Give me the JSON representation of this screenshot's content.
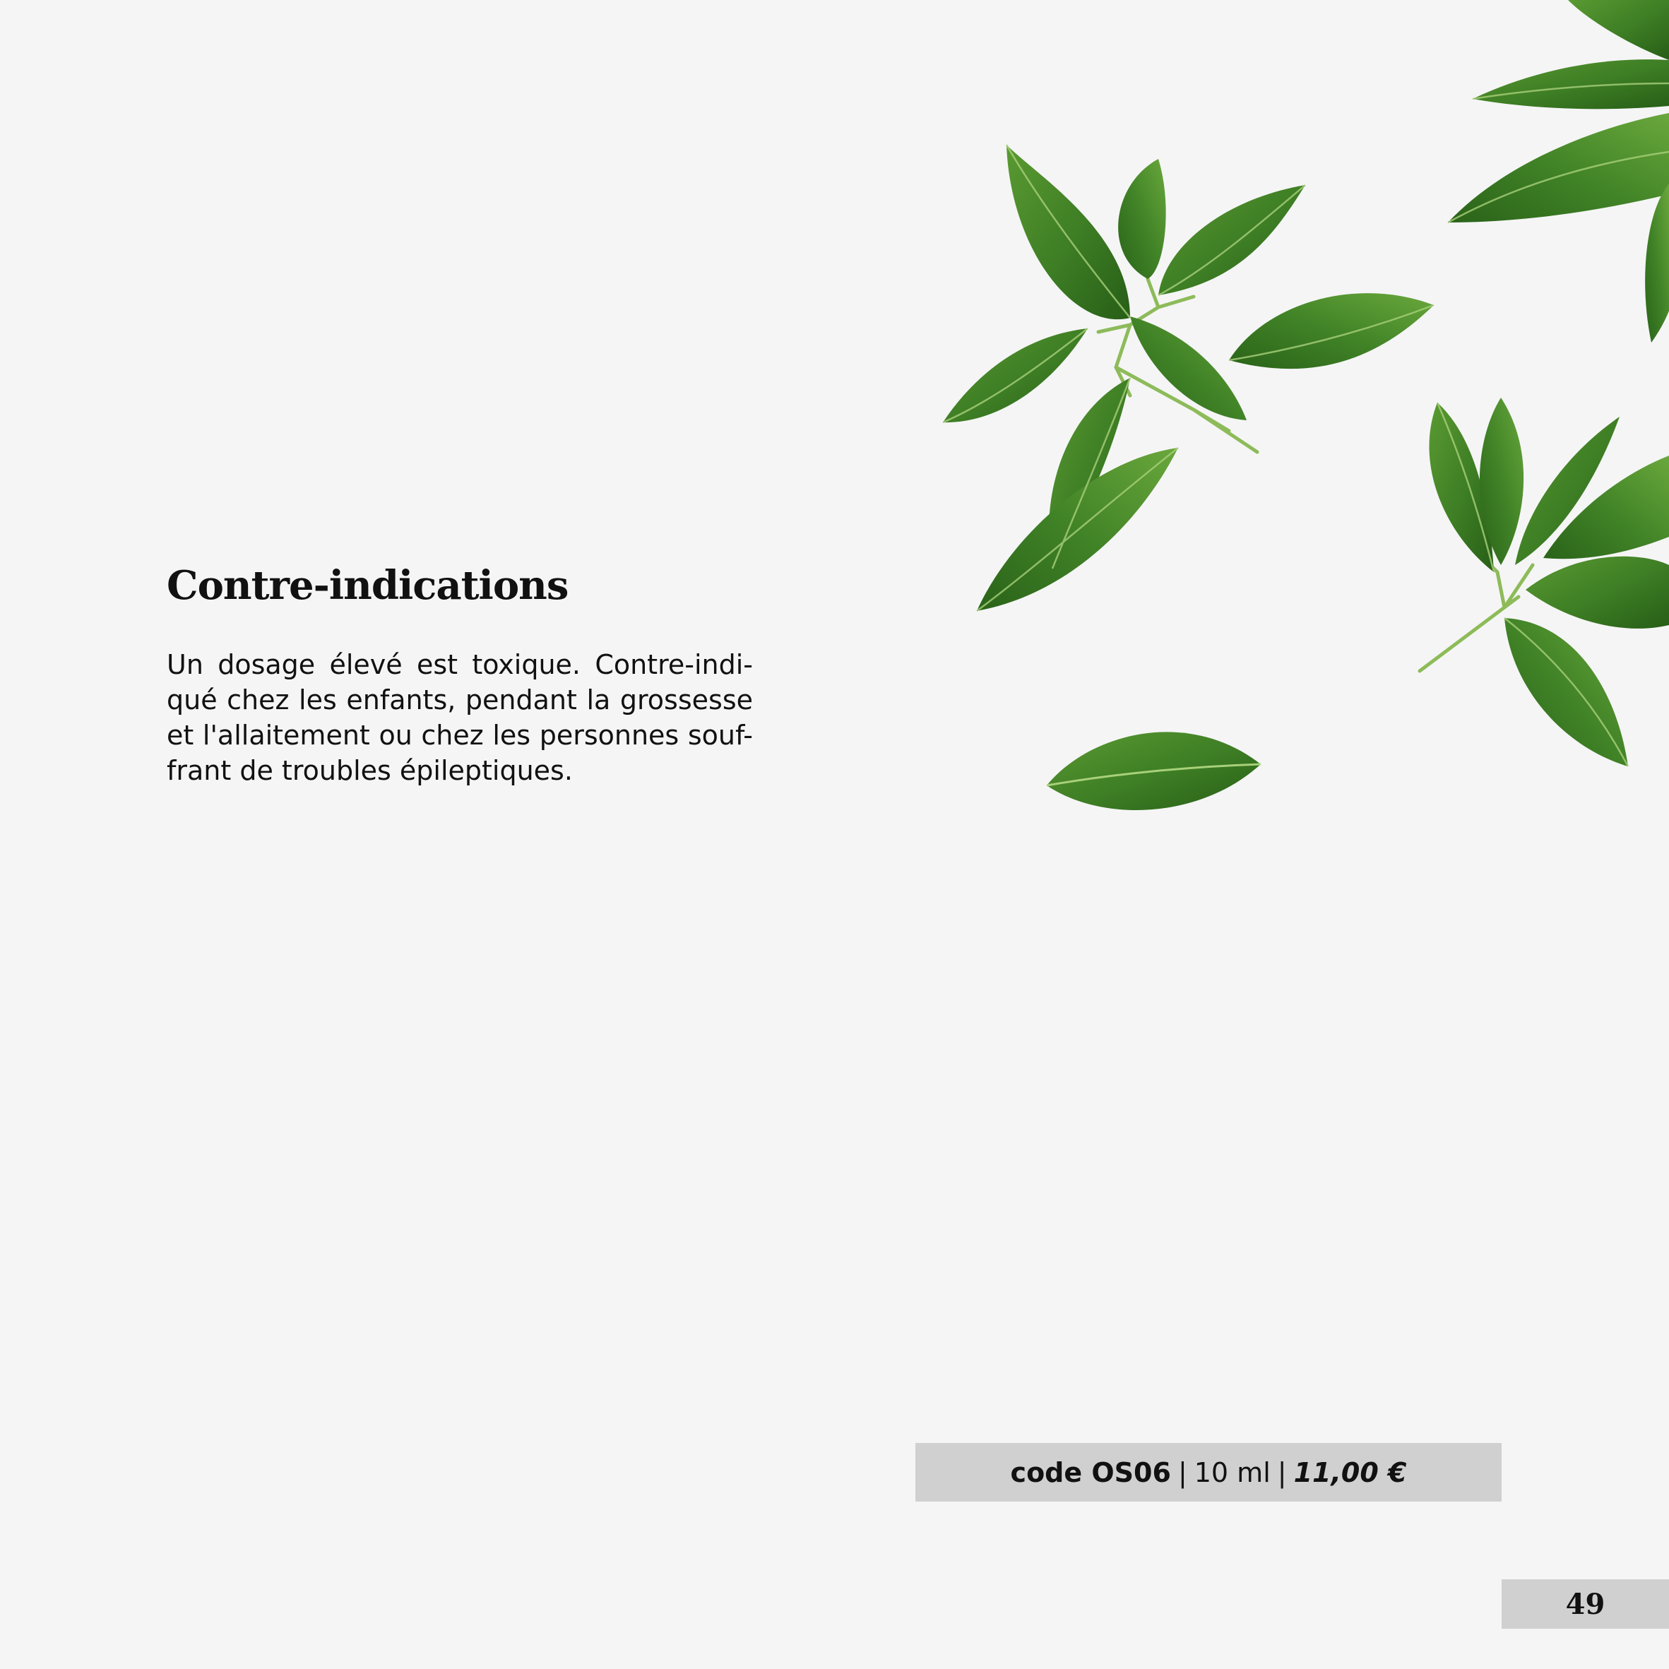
{
  "heading": "Contre-indications",
  "body_lines": [
    "Un dosage élevé est toxique. Contre-indi-",
    "qué chez les enfants, pendant la grossesse",
    "et l'allaitement ou chez les personnes souf-",
    "frant de troubles épileptiques."
  ],
  "product": {
    "code": "code OS06",
    "separator": "|",
    "volume": "10 ml",
    "price": "11,00 €"
  },
  "page_number": "49",
  "colors": {
    "background": "#f5f5f5",
    "bar": "#d0d0d0",
    "leaf_dark": "#2f6e1e",
    "leaf_light": "#5a9a32"
  }
}
